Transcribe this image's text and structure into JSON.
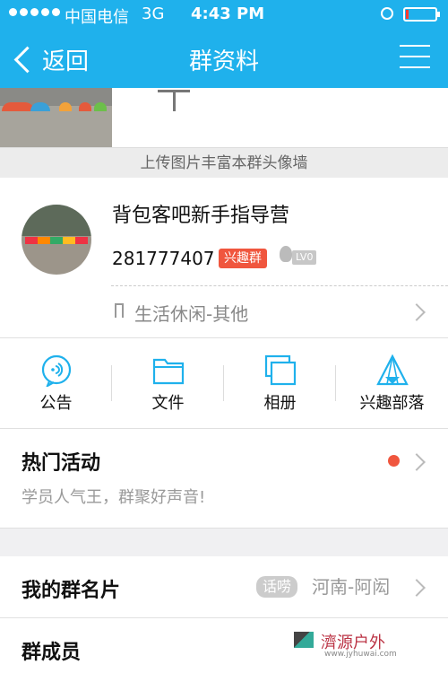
{
  "status_bar": {
    "carrier": "中国电信",
    "network": "3G",
    "time": "4:43 PM",
    "battery_level": 0.1
  },
  "nav": {
    "back_label": "返回",
    "title": "群资料"
  },
  "photo_wall": {
    "upload_hint": "上传图片丰富本群头像墙"
  },
  "group": {
    "name": "背包客吧新手指导营",
    "id": "281777407",
    "badge": "兴趣群",
    "level": "LV0",
    "category": "生活休闲-其他"
  },
  "actions": [
    {
      "label": "公告",
      "icon": "announcement-icon"
    },
    {
      "label": "文件",
      "icon": "folder-icon"
    },
    {
      "label": "相册",
      "icon": "album-icon"
    },
    {
      "label": "兴趣部落",
      "icon": "tribe-tent-icon"
    }
  ],
  "hot_activity": {
    "title": "热门活动",
    "subtitle": "学员人气王，群聚好声音!"
  },
  "my_card": {
    "title": "我的群名片",
    "tag": "话唠",
    "value": "河南-阿闳"
  },
  "members": {
    "title": "群成员"
  },
  "colors": {
    "nav_bg": "#1fb1ec",
    "badge_red": "#f0563e",
    "icon_blue": "#1fb1ec"
  }
}
